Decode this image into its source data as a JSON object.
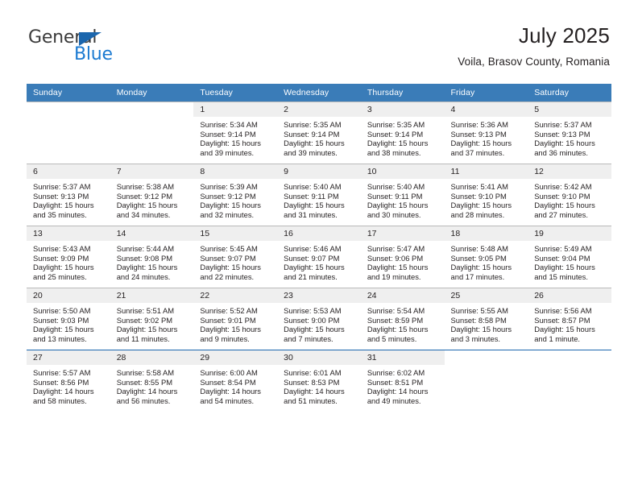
{
  "brand": {
    "name_part1": "General",
    "name_part2": "Blue",
    "triangle_color": "#1b66ad",
    "blue_color": "#1b7ad1"
  },
  "header": {
    "title": "July 2025",
    "subtitle": "Voila, Brasov County, Romania"
  },
  "theme": {
    "header_blue": "#3a7cb8",
    "daynum_gray": "#efefef",
    "row_border": "#b9b9b9",
    "last_row_border": "#1b66ad",
    "text": "#231f20"
  },
  "calendar": {
    "weekday_headers": [
      "Sunday",
      "Monday",
      "Tuesday",
      "Wednesday",
      "Thursday",
      "Friday",
      "Saturday"
    ],
    "labels": {
      "sunrise": "Sunrise:",
      "sunset": "Sunset:",
      "daylight": "Daylight:"
    },
    "weeks": [
      [
        {
          "day": "",
          "empty": true
        },
        {
          "day": "",
          "empty": true
        },
        {
          "day": "1",
          "sunrise": "Sunrise: 5:34 AM",
          "sunset": "Sunset: 9:14 PM",
          "daylight_line1": "Daylight: 15 hours",
          "daylight_line2": "and 39 minutes."
        },
        {
          "day": "2",
          "sunrise": "Sunrise: 5:35 AM",
          "sunset": "Sunset: 9:14 PM",
          "daylight_line1": "Daylight: 15 hours",
          "daylight_line2": "and 39 minutes."
        },
        {
          "day": "3",
          "sunrise": "Sunrise: 5:35 AM",
          "sunset": "Sunset: 9:14 PM",
          "daylight_line1": "Daylight: 15 hours",
          "daylight_line2": "and 38 minutes."
        },
        {
          "day": "4",
          "sunrise": "Sunrise: 5:36 AM",
          "sunset": "Sunset: 9:13 PM",
          "daylight_line1": "Daylight: 15 hours",
          "daylight_line2": "and 37 minutes."
        },
        {
          "day": "5",
          "sunrise": "Sunrise: 5:37 AM",
          "sunset": "Sunset: 9:13 PM",
          "daylight_line1": "Daylight: 15 hours",
          "daylight_line2": "and 36 minutes."
        }
      ],
      [
        {
          "day": "6",
          "sunrise": "Sunrise: 5:37 AM",
          "sunset": "Sunset: 9:13 PM",
          "daylight_line1": "Daylight: 15 hours",
          "daylight_line2": "and 35 minutes."
        },
        {
          "day": "7",
          "sunrise": "Sunrise: 5:38 AM",
          "sunset": "Sunset: 9:12 PM",
          "daylight_line1": "Daylight: 15 hours",
          "daylight_line2": "and 34 minutes."
        },
        {
          "day": "8",
          "sunrise": "Sunrise: 5:39 AM",
          "sunset": "Sunset: 9:12 PM",
          "daylight_line1": "Daylight: 15 hours",
          "daylight_line2": "and 32 minutes."
        },
        {
          "day": "9",
          "sunrise": "Sunrise: 5:40 AM",
          "sunset": "Sunset: 9:11 PM",
          "daylight_line1": "Daylight: 15 hours",
          "daylight_line2": "and 31 minutes."
        },
        {
          "day": "10",
          "sunrise": "Sunrise: 5:40 AM",
          "sunset": "Sunset: 9:11 PM",
          "daylight_line1": "Daylight: 15 hours",
          "daylight_line2": "and 30 minutes."
        },
        {
          "day": "11",
          "sunrise": "Sunrise: 5:41 AM",
          "sunset": "Sunset: 9:10 PM",
          "daylight_line1": "Daylight: 15 hours",
          "daylight_line2": "and 28 minutes."
        },
        {
          "day": "12",
          "sunrise": "Sunrise: 5:42 AM",
          "sunset": "Sunset: 9:10 PM",
          "daylight_line1": "Daylight: 15 hours",
          "daylight_line2": "and 27 minutes."
        }
      ],
      [
        {
          "day": "13",
          "sunrise": "Sunrise: 5:43 AM",
          "sunset": "Sunset: 9:09 PM",
          "daylight_line1": "Daylight: 15 hours",
          "daylight_line2": "and 25 minutes."
        },
        {
          "day": "14",
          "sunrise": "Sunrise: 5:44 AM",
          "sunset": "Sunset: 9:08 PM",
          "daylight_line1": "Daylight: 15 hours",
          "daylight_line2": "and 24 minutes."
        },
        {
          "day": "15",
          "sunrise": "Sunrise: 5:45 AM",
          "sunset": "Sunset: 9:07 PM",
          "daylight_line1": "Daylight: 15 hours",
          "daylight_line2": "and 22 minutes."
        },
        {
          "day": "16",
          "sunrise": "Sunrise: 5:46 AM",
          "sunset": "Sunset: 9:07 PM",
          "daylight_line1": "Daylight: 15 hours",
          "daylight_line2": "and 21 minutes."
        },
        {
          "day": "17",
          "sunrise": "Sunrise: 5:47 AM",
          "sunset": "Sunset: 9:06 PM",
          "daylight_line1": "Daylight: 15 hours",
          "daylight_line2": "and 19 minutes."
        },
        {
          "day": "18",
          "sunrise": "Sunrise: 5:48 AM",
          "sunset": "Sunset: 9:05 PM",
          "daylight_line1": "Daylight: 15 hours",
          "daylight_line2": "and 17 minutes."
        },
        {
          "day": "19",
          "sunrise": "Sunrise: 5:49 AM",
          "sunset": "Sunset: 9:04 PM",
          "daylight_line1": "Daylight: 15 hours",
          "daylight_line2": "and 15 minutes."
        }
      ],
      [
        {
          "day": "20",
          "sunrise": "Sunrise: 5:50 AM",
          "sunset": "Sunset: 9:03 PM",
          "daylight_line1": "Daylight: 15 hours",
          "daylight_line2": "and 13 minutes."
        },
        {
          "day": "21",
          "sunrise": "Sunrise: 5:51 AM",
          "sunset": "Sunset: 9:02 PM",
          "daylight_line1": "Daylight: 15 hours",
          "daylight_line2": "and 11 minutes."
        },
        {
          "day": "22",
          "sunrise": "Sunrise: 5:52 AM",
          "sunset": "Sunset: 9:01 PM",
          "daylight_line1": "Daylight: 15 hours",
          "daylight_line2": "and 9 minutes."
        },
        {
          "day": "23",
          "sunrise": "Sunrise: 5:53 AM",
          "sunset": "Sunset: 9:00 PM",
          "daylight_line1": "Daylight: 15 hours",
          "daylight_line2": "and 7 minutes."
        },
        {
          "day": "24",
          "sunrise": "Sunrise: 5:54 AM",
          "sunset": "Sunset: 8:59 PM",
          "daylight_line1": "Daylight: 15 hours",
          "daylight_line2": "and 5 minutes."
        },
        {
          "day": "25",
          "sunrise": "Sunrise: 5:55 AM",
          "sunset": "Sunset: 8:58 PM",
          "daylight_line1": "Daylight: 15 hours",
          "daylight_line2": "and 3 minutes."
        },
        {
          "day": "26",
          "sunrise": "Sunrise: 5:56 AM",
          "sunset": "Sunset: 8:57 PM",
          "daylight_line1": "Daylight: 15 hours",
          "daylight_line2": "and 1 minute."
        }
      ],
      [
        {
          "day": "27",
          "sunrise": "Sunrise: 5:57 AM",
          "sunset": "Sunset: 8:56 PM",
          "daylight_line1": "Daylight: 14 hours",
          "daylight_line2": "and 58 minutes."
        },
        {
          "day": "28",
          "sunrise": "Sunrise: 5:58 AM",
          "sunset": "Sunset: 8:55 PM",
          "daylight_line1": "Daylight: 14 hours",
          "daylight_line2": "and 56 minutes."
        },
        {
          "day": "29",
          "sunrise": "Sunrise: 6:00 AM",
          "sunset": "Sunset: 8:54 PM",
          "daylight_line1": "Daylight: 14 hours",
          "daylight_line2": "and 54 minutes."
        },
        {
          "day": "30",
          "sunrise": "Sunrise: 6:01 AM",
          "sunset": "Sunset: 8:53 PM",
          "daylight_line1": "Daylight: 14 hours",
          "daylight_line2": "and 51 minutes."
        },
        {
          "day": "31",
          "sunrise": "Sunrise: 6:02 AM",
          "sunset": "Sunset: 8:51 PM",
          "daylight_line1": "Daylight: 14 hours",
          "daylight_line2": "and 49 minutes."
        },
        {
          "day": "",
          "empty": true
        },
        {
          "day": "",
          "empty": true
        }
      ]
    ]
  }
}
